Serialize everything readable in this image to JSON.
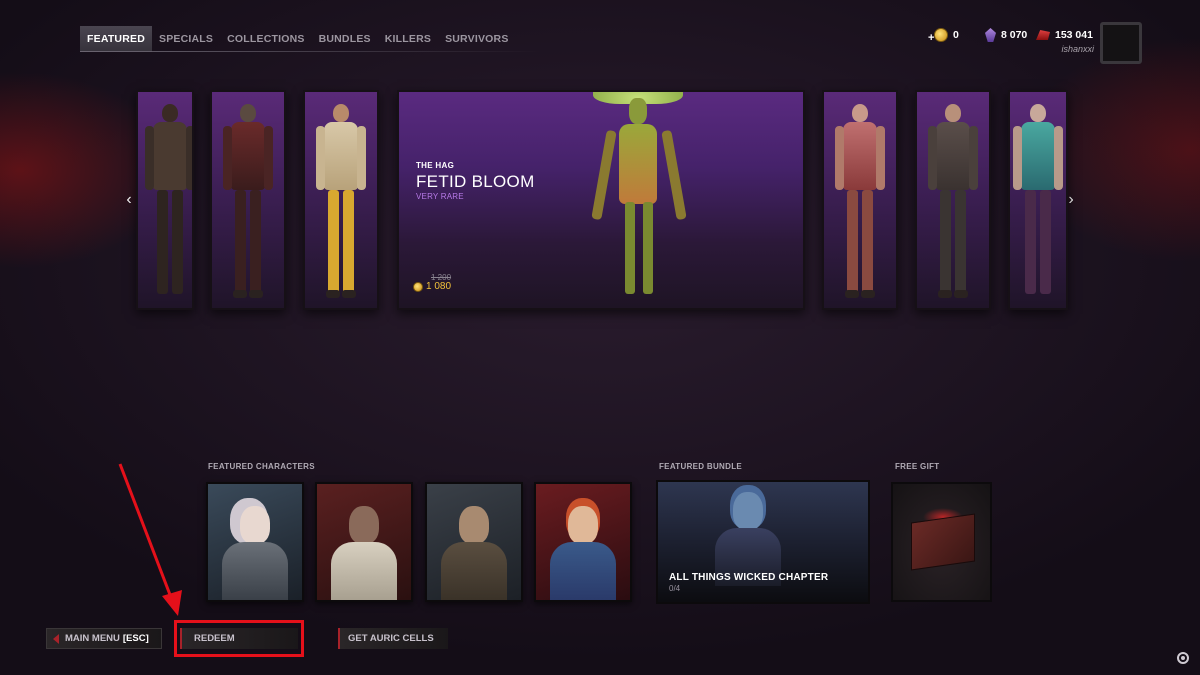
{
  "nav": {
    "tabs": [
      {
        "label": "FEATURED",
        "active": true
      },
      {
        "label": "SPECIALS"
      },
      {
        "label": "COLLECTIONS"
      },
      {
        "label": "BUNDLES"
      },
      {
        "label": "KILLERS"
      },
      {
        "label": "SURVIVORS"
      }
    ]
  },
  "currency": {
    "auric_cells": "0",
    "iridescent_shards": "8 070",
    "bloodpoints": "153 041",
    "username": "ishanxxi"
  },
  "carousel": {
    "featured": {
      "killer": "THE HAG",
      "name": "FETID BLOOM",
      "rarity": "VERY RARE",
      "old_price": "1 200",
      "price": "1 080"
    },
    "prev_arrow": "‹",
    "next_arrow": "›"
  },
  "sections": {
    "featured_characters": "FEATURED CHARACTERS",
    "featured_bundle": "FEATURED BUNDLE",
    "free_gift": "FREE GIFT"
  },
  "bundle": {
    "title": "ALL THINGS WICKED CHAPTER",
    "count": "0/4"
  },
  "bottom": {
    "main_menu": "MAIN MENU",
    "main_menu_key": "[ESC]",
    "redeem": "REDEEM",
    "get_auric_cells": "GET AURIC CELLS"
  },
  "colors": {
    "accent_red": "#a8222a",
    "highlight_red": "#e5101a",
    "rarity_purple": "#b77ae8",
    "price_gold": "#f2c23a"
  }
}
